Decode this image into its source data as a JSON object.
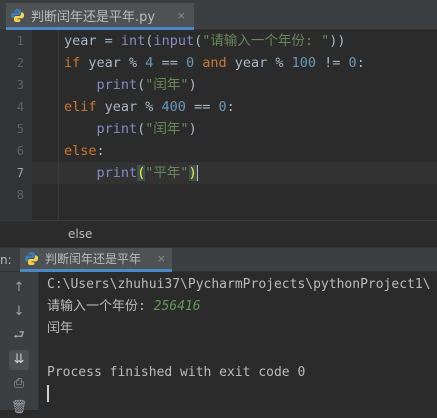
{
  "tab": {
    "filename": "判断闰年还是平年.py",
    "close": "×"
  },
  "editor": {
    "line_numbers": [
      "1",
      "2",
      "3",
      "4",
      "5",
      "6",
      "7",
      "8"
    ],
    "current_line": 7,
    "lines": [
      [
        [
          "t",
          "year = "
        ],
        [
          "fn",
          "int"
        ],
        [
          "t",
          "("
        ],
        [
          "fn",
          "input"
        ],
        [
          "t",
          "("
        ],
        [
          "s",
          "\"请输入一个年份: \""
        ],
        [
          "t",
          "))"
        ]
      ],
      [
        [
          "k",
          "if "
        ],
        [
          "t",
          "year % "
        ],
        [
          "n",
          "4"
        ],
        [
          "t",
          " == "
        ],
        [
          "n",
          "0"
        ],
        [
          "k",
          " and "
        ],
        [
          "t",
          "year % "
        ],
        [
          "n",
          "100"
        ],
        [
          "t",
          " != "
        ],
        [
          "n",
          "0"
        ],
        [
          "t",
          ":"
        ]
      ],
      [
        [
          "t",
          "    "
        ],
        [
          "fn",
          "print"
        ],
        [
          "t",
          "("
        ],
        [
          "s",
          "\"闰年\""
        ],
        [
          "t",
          ")"
        ]
      ],
      [
        [
          "k",
          "elif "
        ],
        [
          "t",
          "year % "
        ],
        [
          "n",
          "400"
        ],
        [
          "t",
          " == "
        ],
        [
          "n",
          "0"
        ],
        [
          "t",
          ":"
        ]
      ],
      [
        [
          "t",
          "    "
        ],
        [
          "fn",
          "print"
        ],
        [
          "t",
          "("
        ],
        [
          "s",
          "\"闰年\""
        ],
        [
          "t",
          ")"
        ]
      ],
      [
        [
          "k",
          "else"
        ],
        [
          "t",
          ":"
        ]
      ],
      [
        [
          "t",
          "    "
        ],
        [
          "fn",
          "print"
        ],
        [
          "b",
          "("
        ],
        [
          "s",
          "\"平年\""
        ],
        [
          "b",
          ")"
        ],
        [
          "c",
          ""
        ]
      ],
      []
    ]
  },
  "breadcrumb": {
    "text": "else"
  },
  "run": {
    "prefix": "n:",
    "tab_label": "判断闰年还是平年",
    "close": "×",
    "sidebar_buttons": [
      {
        "name": "rerun-up-icon",
        "glyph": "↑"
      },
      {
        "name": "scroll-down-icon",
        "glyph": "↓"
      },
      {
        "name": "soft-wrap-icon",
        "glyph": "⮐"
      },
      {
        "name": "scroll-to-end-icon",
        "glyph": "⇊"
      },
      {
        "name": "print-icon",
        "glyph": "⎙"
      },
      {
        "name": "delete-icon",
        "glyph": "🗑"
      }
    ],
    "console": {
      "command": "C:\\Users\\zhuhui37\\PycharmProjects\\pythonProject1\\",
      "prompt": "请输入一个年份: ",
      "input": "256416",
      "result": "闰年",
      "exit": "Process finished with exit code 0"
    }
  },
  "colors": {
    "keyword": "#cc7832",
    "builtin": "#8888c6",
    "string": "#6a8759",
    "number": "#6897bb",
    "accent": "#4a88c7"
  }
}
